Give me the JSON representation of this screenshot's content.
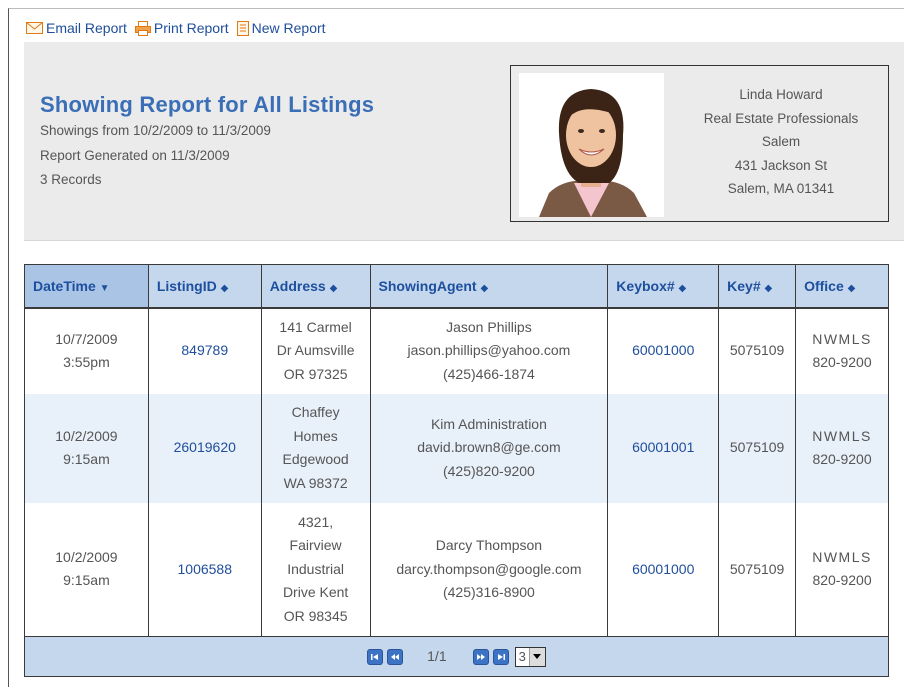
{
  "toolbar": {
    "email_label": "Email Report",
    "print_label": "Print Report",
    "new_label": "New Report"
  },
  "report": {
    "title": "Showing Report for All Listings",
    "date_range": "Showings from 10/2/2009 to 11/3/2009",
    "generated": "Report Generated on 11/3/2009",
    "records": "3 Records"
  },
  "agent": {
    "name": "Linda Howard",
    "company": "Real Estate Professionals",
    "office": "Salem",
    "street": "431 Jackson St",
    "city": "Salem, MA 01341"
  },
  "table": {
    "columns": [
      {
        "label": "DateTime",
        "sort_icon": "▼"
      },
      {
        "label": "ListingID",
        "sort_icon": "◆"
      },
      {
        "label": "Address",
        "sort_icon": "◆"
      },
      {
        "label": "ShowingAgent",
        "sort_icon": "◆"
      },
      {
        "label": "Keybox#",
        "sort_icon": "◆"
      },
      {
        "label": "Key#",
        "sort_icon": "◆"
      },
      {
        "label": "Office",
        "sort_icon": "◆"
      }
    ],
    "rows": [
      {
        "date": "10/7/2009",
        "time": "3:55pm",
        "listing_id": "849789",
        "address": [
          "141 Carmel",
          "Dr Aumsville",
          "OR 97325"
        ],
        "agent_name": "Jason Phillips",
        "agent_email": "jason.phillips@yahoo.com",
        "agent_phone": "(425)466-1874",
        "keybox": "60001000",
        "key": "5075109",
        "office_name": "NWMLS",
        "office_phone": "820-9200"
      },
      {
        "date": "10/2/2009",
        "time": "9:15am",
        "listing_id": "26019620",
        "address": [
          "Chaffey",
          "Homes",
          "Edgewood",
          "WA 98372"
        ],
        "agent_name": "Kim Administration",
        "agent_email": "david.brown8@ge.com",
        "agent_phone": "(425)820-9200",
        "keybox": "60001001",
        "key": "5075109",
        "office_name": "NWMLS",
        "office_phone": "820-9200"
      },
      {
        "date": "10/2/2009",
        "time": "9:15am",
        "listing_id": "1006588",
        "address": [
          "4321,",
          "Fairview",
          "Industrial",
          "Drive Kent",
          "OR 98345"
        ],
        "agent_name": "Darcy Thompson",
        "agent_email": "darcy.thompson@google.com",
        "agent_phone": "(425)316-8900",
        "keybox": "60001000",
        "key": "5075109",
        "office_name": "NWMLS",
        "office_phone": "820-9200"
      }
    ]
  },
  "pager": {
    "page_text": "1/1",
    "page_size": "3"
  },
  "colors": {
    "link": "#1f4e9c",
    "title": "#3a6fb7",
    "header_bg": "#c5d7ec",
    "alt_row": "#e8f0fa"
  }
}
